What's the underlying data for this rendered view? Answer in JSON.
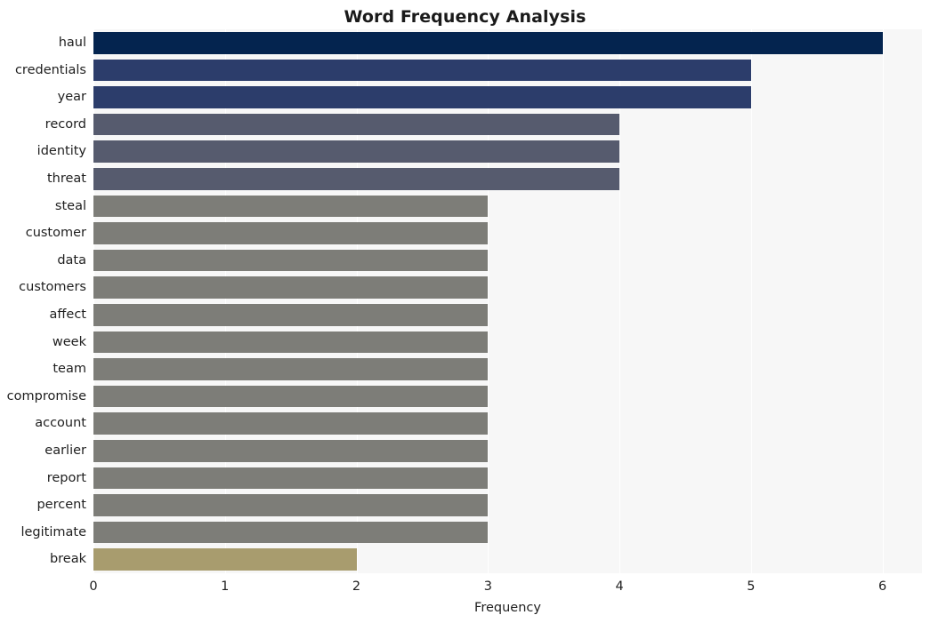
{
  "chart_data": {
    "type": "bar",
    "orientation": "horizontal",
    "title": "Word Frequency Analysis",
    "xlabel": "Frequency",
    "ylabel": "",
    "xlim": [
      0,
      6.3
    ],
    "xticks": [
      0,
      1,
      2,
      3,
      4,
      5,
      6
    ],
    "xtick_labels": [
      "0",
      "1",
      "2",
      "3",
      "4",
      "5",
      "6"
    ],
    "grid": "vertical-white-on-light-gray",
    "legend": "none",
    "categories": [
      "haul",
      "credentials",
      "year",
      "record",
      "identity",
      "threat",
      "steal",
      "customer",
      "data",
      "customers",
      "affect",
      "week",
      "team",
      "compromise",
      "account",
      "earlier",
      "report",
      "percent",
      "legitimate",
      "break"
    ],
    "values": [
      6,
      5,
      5,
      4,
      4,
      4,
      3,
      3,
      3,
      3,
      3,
      3,
      3,
      3,
      3,
      3,
      3,
      3,
      3,
      2
    ],
    "bar_colors": [
      "#04244f",
      "#2c3d6b",
      "#2c3d6b",
      "#565b6e",
      "#565b6e",
      "#565b6e",
      "#7d7d78",
      "#7d7d78",
      "#7d7d78",
      "#7d7d78",
      "#7d7d78",
      "#7d7d78",
      "#7d7d78",
      "#7d7d78",
      "#7d7d78",
      "#7d7d78",
      "#7d7d78",
      "#7d7d78",
      "#7d7d78",
      "#a89c6e"
    ],
    "plot_background": "#f7f7f7",
    "gridline_color": "#ffffff",
    "figure_background": "#ffffff",
    "text_color": "#1f1f1f"
  }
}
